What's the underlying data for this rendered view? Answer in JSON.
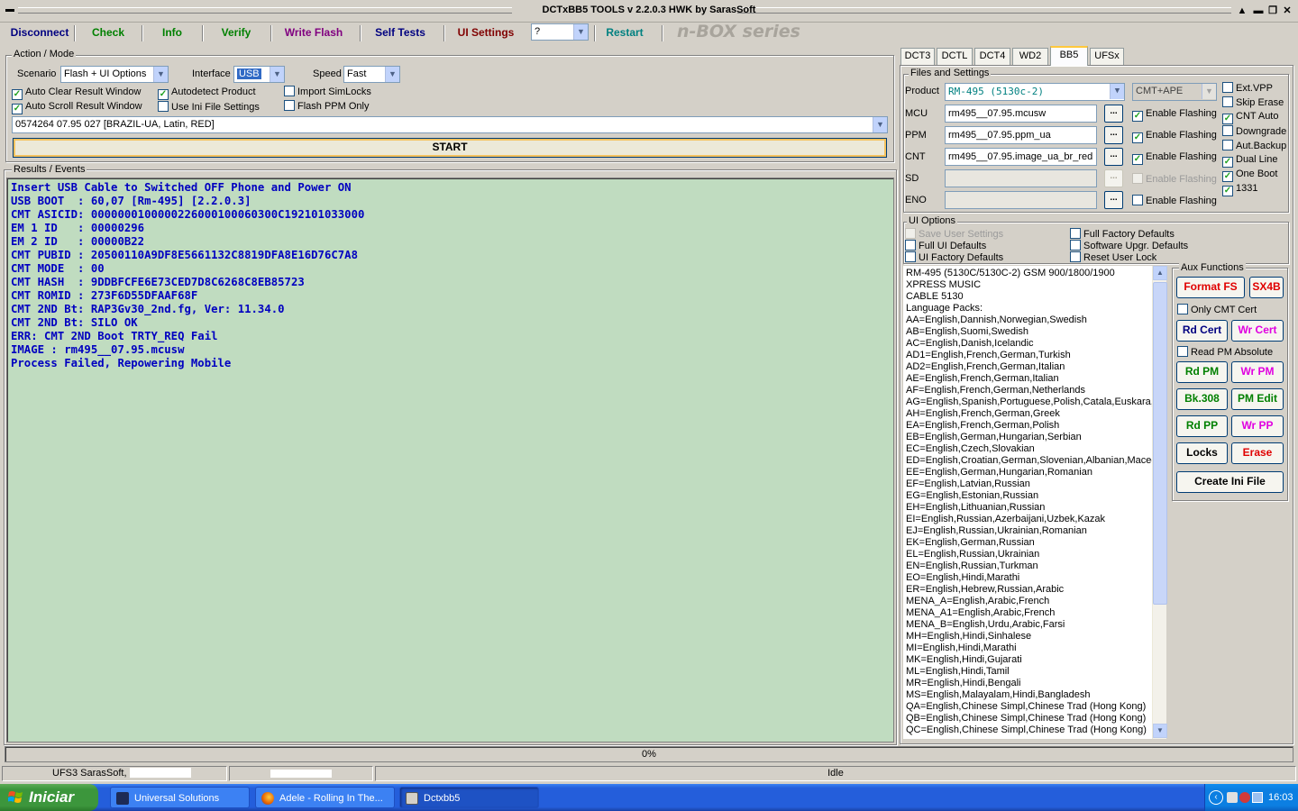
{
  "window": {
    "title": "DCTxBB5 TOOLS v 2.2.0.3 HWK by SarasSoft",
    "controls": [
      "▲",
      "▬",
      "❐",
      "✕"
    ]
  },
  "toolbar": {
    "disconnect": "Disconnect",
    "check": "Check",
    "info": "Info",
    "verify": "Verify",
    "write_flash": "Write Flash",
    "self_tests": "Self Tests",
    "ui_settings": "UI Settings",
    "help_combo": "?",
    "restart": "Restart",
    "brand": "n-BOX series",
    "colors": {
      "disconnect": "#000080",
      "check": "#008000",
      "info": "#008000",
      "verify": "#008000",
      "write_flash": "#800080",
      "self_tests": "#000080",
      "ui_settings": "#800000",
      "restart": "#008080"
    }
  },
  "action": {
    "title": "Action / Mode",
    "scenario_label": "Scenario",
    "scenario_value": "Flash + UI Options",
    "interface_label": "Interface",
    "interface_value": "USB",
    "speed_label": "Speed",
    "speed_value": "Fast",
    "checks": [
      {
        "label": "Auto Clear Result Window",
        "checked": true
      },
      {
        "label": "Auto Scroll Result Window",
        "checked": true
      },
      {
        "label": "Autodetect Product",
        "checked": true
      },
      {
        "label": "Use Ini File Settings",
        "checked": false
      },
      {
        "label": "Import SimLocks",
        "checked": false
      },
      {
        "label": "Flash PPM Only",
        "checked": false
      }
    ],
    "variant": "0574264 07.95 027  [BRAZIL-UA, Latin, RED]",
    "start_label": "START"
  },
  "results": {
    "title": "Results / Events",
    "lines": [
      "Insert USB Cable to Switched OFF Phone and Power ON",
      "USB BOOT  : 60,07 [Rm-495] [2.2.0.3]",
      "CMT ASICID: 0000000100000226000100060300C192101033000",
      "EM 1 ID   : 00000296",
      "EM 2 ID   : 00000B22",
      "CMT PUBID : 20500110A9DF8E5661132C8819DFA8E16D76C7A8",
      "CMT MODE  : 00",
      "CMT HASH  : 9DDBFCFE6E73CED7D8C6268C8EB85723",
      "CMT ROMID : 273F6D55DFAAF68F",
      "CMT 2ND Bt: RAP3Gv30_2nd.fg, Ver: 11.34.0",
      "CMT 2ND Bt: SILO OK",
      "ERR: CMT 2ND Boot TRTY_REQ Fail",
      "IMAGE : rm495__07.95.mcusw",
      "Process Failed, Repowering Mobile"
    ]
  },
  "tabs": [
    "DCT3",
    "DCTL",
    "DCT4",
    "WD2",
    "BB5",
    "UFSx"
  ],
  "files": {
    "title": "Files and Settings",
    "product_label": "Product",
    "product_value": "RM-495 (5130c-2)",
    "cmt_mode": "CMT+APE",
    "rows": [
      {
        "label": "MCU",
        "value": "rm495__07.95.mcusw",
        "flash": "Enable Flashing",
        "checked": true,
        "enabled": true
      },
      {
        "label": "PPM",
        "value": "rm495__07.95.ppm_ua",
        "flash": "Enable Flashing",
        "checked": true,
        "enabled": true
      },
      {
        "label": "CNT",
        "value": "rm495__07.95.image_ua_br_red",
        "flash": "Enable Flashing",
        "checked": true,
        "enabled": true
      },
      {
        "label": "SD",
        "value": "",
        "flash": "Enable Flashing",
        "checked": false,
        "enabled": false
      },
      {
        "label": "ENO",
        "value": "",
        "flash": "Enable Flashing",
        "checked": false,
        "enabled": true
      }
    ],
    "dots": "...",
    "side_checks": [
      {
        "label": "Ext.VPP",
        "checked": false
      },
      {
        "label": "Skip Erase",
        "checked": false
      },
      {
        "label": "CNT Auto",
        "checked": true
      },
      {
        "label": "Downgrade",
        "checked": false
      },
      {
        "label": "Aut.Backup",
        "checked": false
      },
      {
        "label": "Dual Line",
        "checked": true
      },
      {
        "label": "One Boot",
        "checked": true
      },
      {
        "label": "1331",
        "checked": true
      }
    ]
  },
  "ui_options": {
    "title": "UI Options",
    "left": [
      {
        "label": "Save User Settings",
        "checked": false,
        "enabled": false
      },
      {
        "label": "Full UI Defaults",
        "checked": false,
        "enabled": true
      },
      {
        "label": "UI Factory Defaults",
        "checked": false,
        "enabled": true
      }
    ],
    "right": [
      {
        "label": "Full Factory Defaults",
        "checked": false,
        "enabled": true
      },
      {
        "label": "Software Upgr. Defaults",
        "checked": false,
        "enabled": true
      },
      {
        "label": "Reset User Lock",
        "checked": false,
        "enabled": true
      }
    ]
  },
  "info_list": [
    "    RM-495 (5130C/5130C-2) GSM 900/1800/1900",
    "XPRESS MUSIC",
    "CABLE 5130",
    "Language Packs:",
    "AA=English,Dannish,Norwegian,Swedish",
    "AB=English,Suomi,Swedish",
    "AC=English,Danish,Icelandic",
    "AD1=English,French,German,Turkish",
    "AD2=English,French,German,Italian",
    "AE=English,French,German,Italian",
    "AF=English,French,German,Netherlands",
    "AG=English,Spanish,Portuguese,Polish,Catala,Euskara,G",
    "AH=English,French,German,Greek",
    "EA=English,French,German,Polish",
    "EB=English,German,Hungarian,Serbian",
    "EC=English,Czech,Slovakian",
    "ED=English,Croatian,German,Slovenian,Albanian,Macedo",
    "EE=English,German,Hungarian,Romanian",
    "EF=English,Latvian,Russian",
    "EG=English,Estonian,Russian",
    "EH=English,Lithuanian,Russian",
    "EI=English,Russian,Azerbaijani,Uzbek,Kazak",
    "EJ=English,Russian,Ukrainian,Romanian",
    "EK=English,German,Russian",
    "EL=English,Russian,Ukrainian",
    "EN=English,Russian,Turkman",
    "EO=English,Hindi,Marathi",
    "ER=English,Hebrew,Russian,Arabic",
    "MENA_A=English,Arabic,French",
    "MENA_A1=English,Arabic,French",
    "MENA_B=English,Urdu,Arabic,Farsi",
    "MH=English,Hindi,Sinhalese",
    "MI=English,Hindi,Marathi",
    "MK=English,Hindi,Gujarati",
    "ML=English,Hindi,Tamil",
    "MR=English,Hindi,Bengali",
    "MS=English,Malayalam,Hindi,Bangladesh",
    "QA=English,Chinese Simpl,Chinese Trad (Hong Kong)",
    "QB=English,Chinese Simpl,Chinese Trad (Hong Kong)",
    "QC=English,Chinese Simpl,Chinese Trad (Hong Kong)"
  ],
  "aux": {
    "title": "Aux Functions",
    "format_fs": "Format FS",
    "sx4b": "SX4B",
    "only_cmt_cert": "Only CMT Cert",
    "rd_cert": "Rd Cert",
    "wr_cert": "Wr Cert",
    "read_pm_absolute": "Read PM Absolute",
    "rd_pm": "Rd PM",
    "wr_pm": "Wr PM",
    "bk308": "Bk.308",
    "pm_edit": "PM Edit",
    "rd_pp": "Rd PP",
    "wr_pp": "Wr PP",
    "locks": "Locks",
    "erase": "Erase",
    "create_ini": "Create Ini File",
    "colors": {
      "red": "#e00000",
      "magenta": "#e000e0",
      "green": "#008000",
      "blue": "#000080",
      "black": "#000000"
    }
  },
  "progress": {
    "value": 0,
    "text": "0%"
  },
  "status": {
    "left": "UFS3 SarasSoft,",
    "right": "Idle"
  },
  "taskbar": {
    "start": "Iniciar",
    "tasks": [
      "Universal Solutions",
      "Adele - Rolling In The...",
      "Dctxbb5"
    ],
    "clock": "16:03"
  }
}
